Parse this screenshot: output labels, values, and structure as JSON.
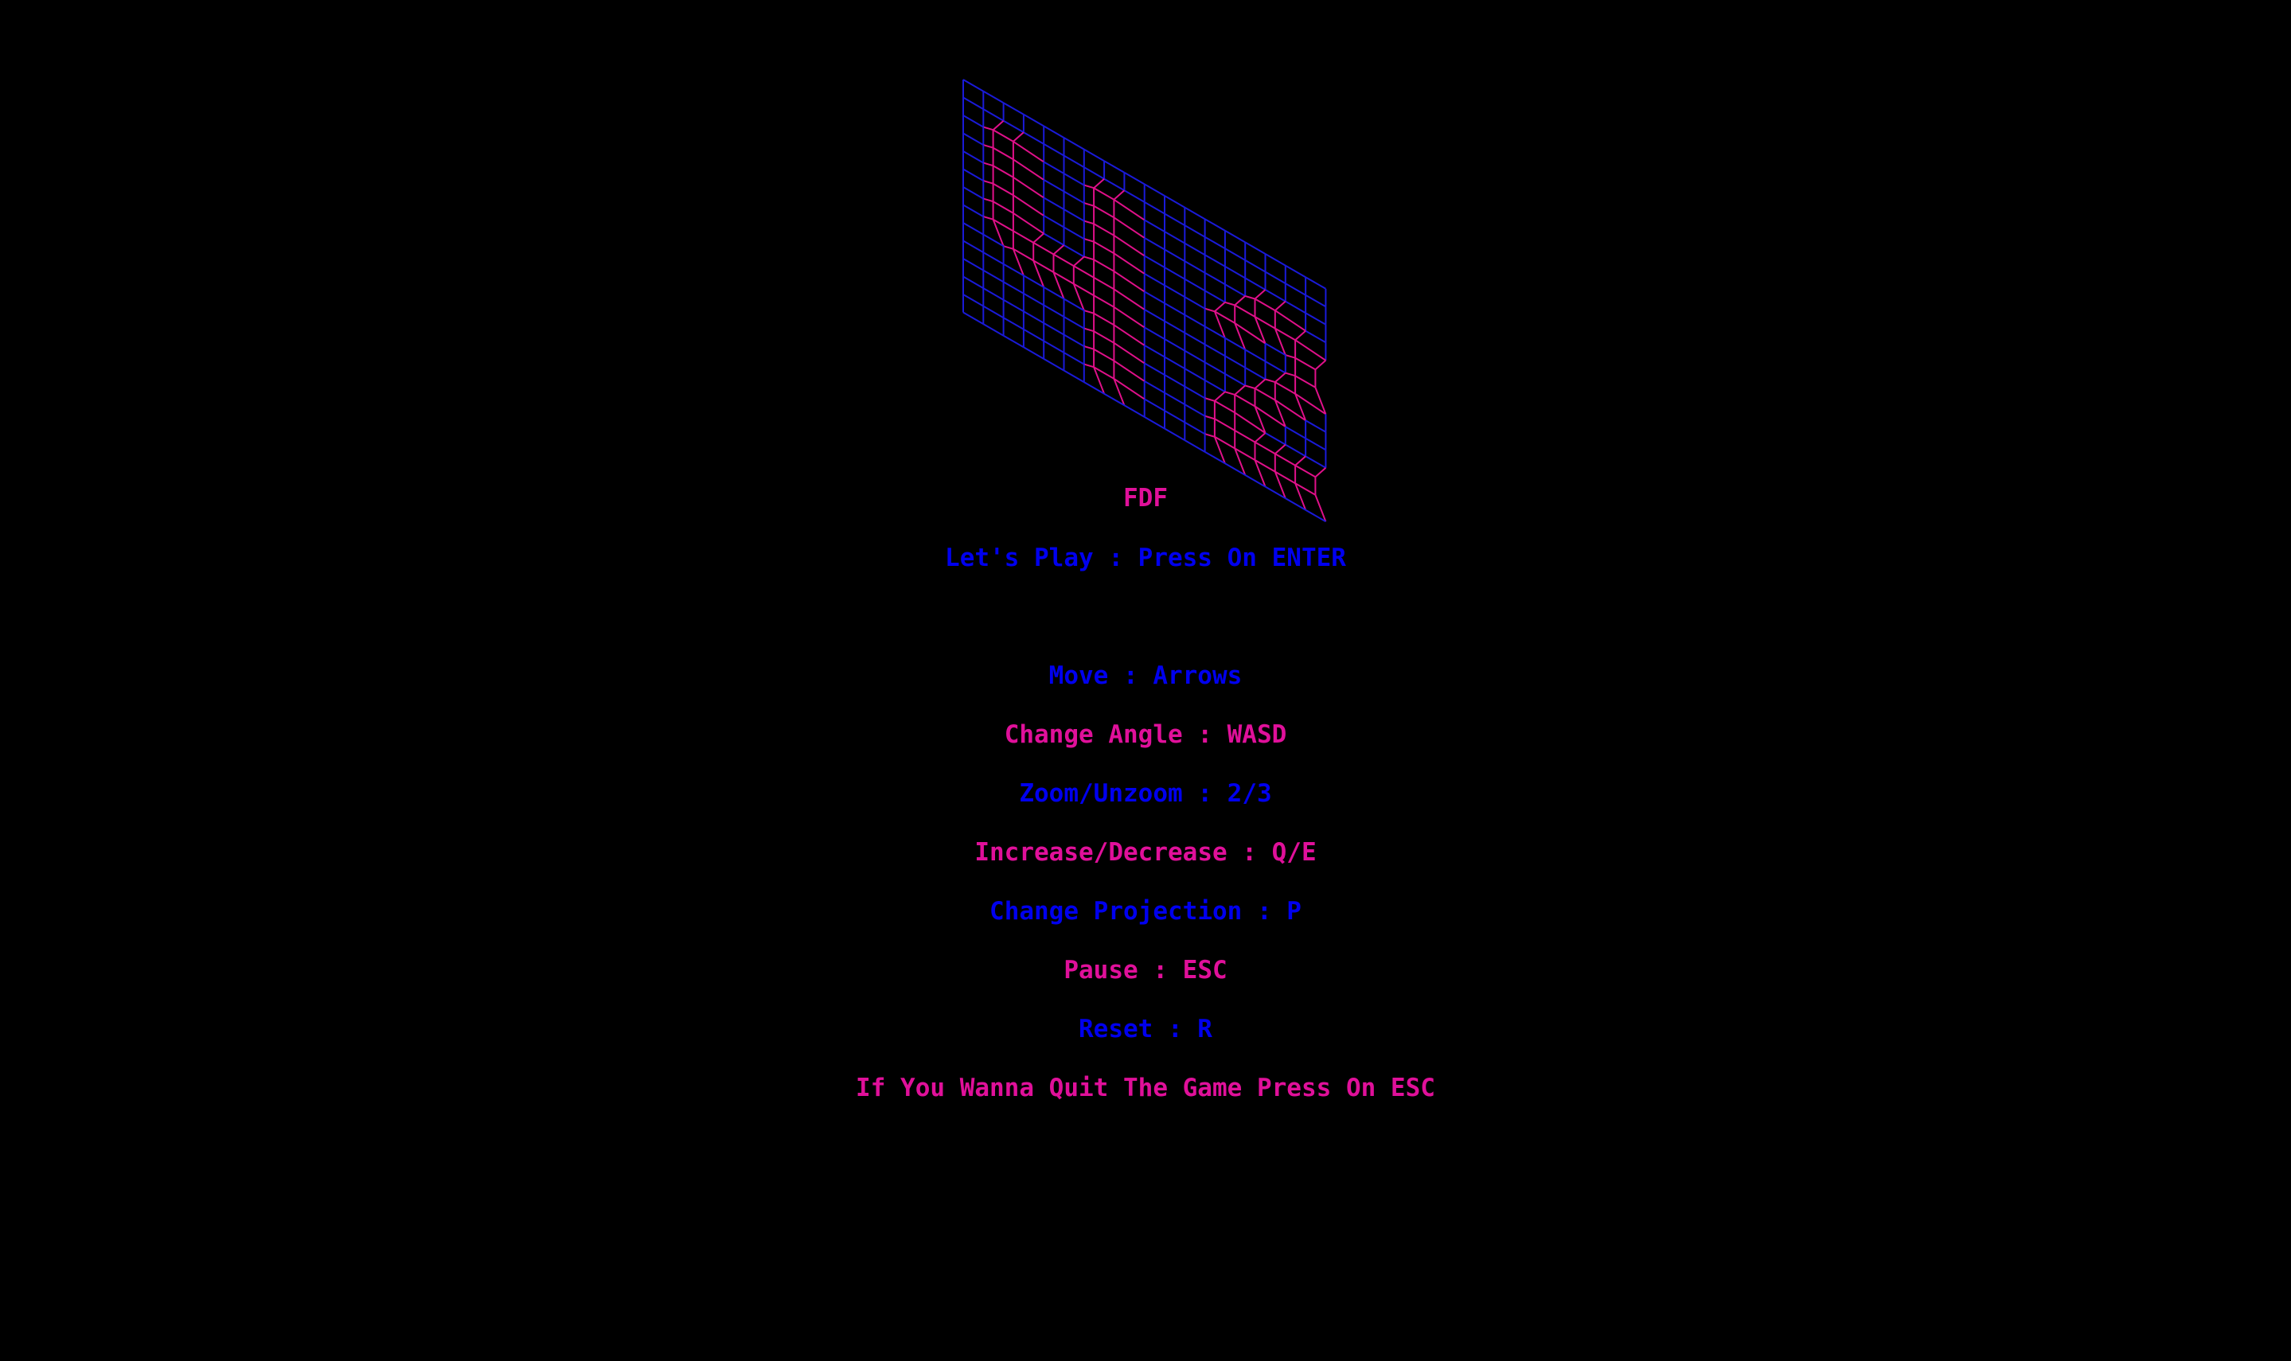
{
  "title": "FDF",
  "colors": {
    "background": "#000000",
    "blue": "#0000ee",
    "magenta": "#e0109a",
    "grid_blue": "#1a1ad8",
    "grid_raised": "#e0108a"
  },
  "menu": {
    "lines": [
      {
        "text": "FDF",
        "color": "magenta"
      },
      {
        "text": "Let's Play : Press On ENTER",
        "color": "blue"
      },
      {
        "text": "Move : Arrows",
        "color": "blue"
      },
      {
        "text": "Change Angle : WASD",
        "color": "magenta"
      },
      {
        "text": "Zoom/Unzoom : 2/3",
        "color": "blue"
      },
      {
        "text": "Increase/Decrease : Q/E",
        "color": "magenta"
      },
      {
        "text": "Change Projection : P",
        "color": "blue"
      },
      {
        "text": "Pause : ESC",
        "color": "magenta"
      },
      {
        "text": "Reset : R",
        "color": "blue"
      },
      {
        "text": "If You Wanna Quit The Game Press On ESC",
        "color": "magenta"
      }
    ]
  },
  "map": {
    "name": "42",
    "rows": [
      "0000000000000000000",
      "0000000000000000000",
      "0011000110000000000",
      "0011000110000001100",
      "0011000110000011110",
      "0011000110000110011",
      "0011000110000000011",
      "0011111110000000110",
      "0001111110000001100",
      "0000000110000011000",
      "0000000110000110000",
      "0000000110000111111",
      "0000000110000111111",
      "0000000000000000000"
    ],
    "height_value": 10
  }
}
